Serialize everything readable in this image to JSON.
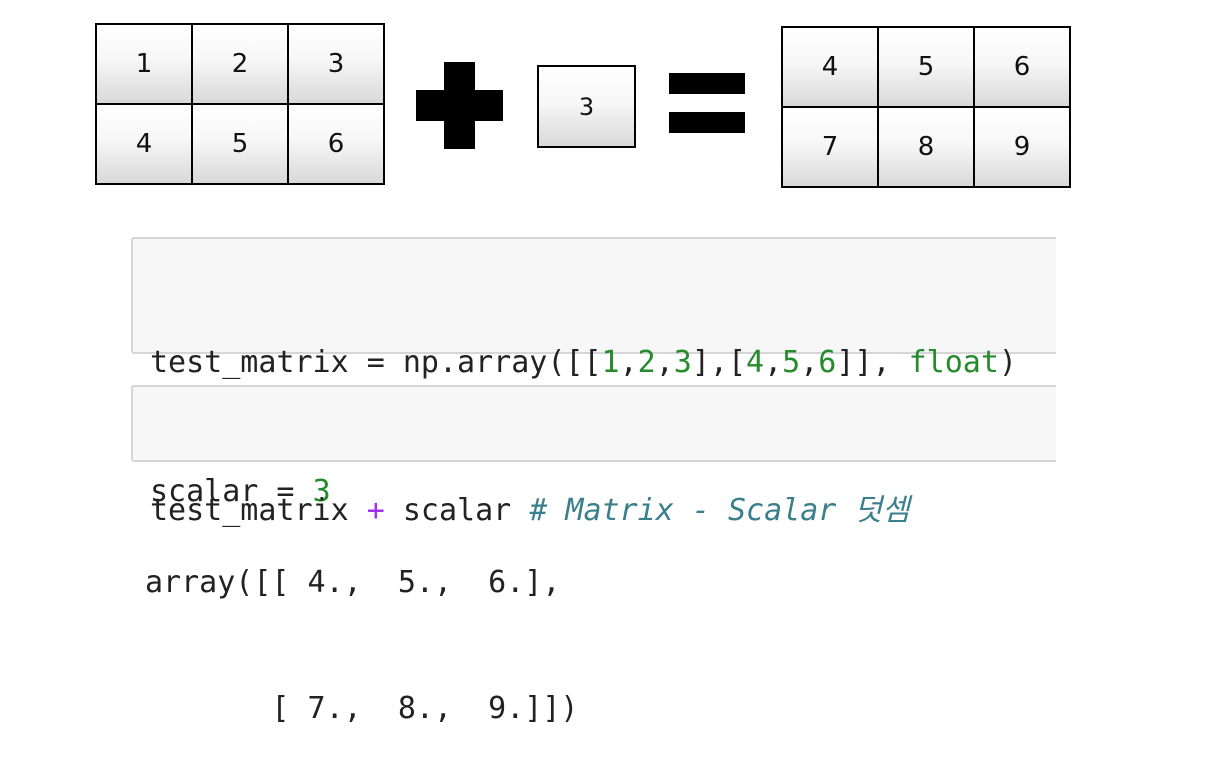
{
  "diagram": {
    "matrix_left": {
      "rows": [
        [
          "1",
          "2",
          "3"
        ],
        [
          "4",
          "5",
          "6"
        ]
      ]
    },
    "scalar": "3",
    "matrix_result": {
      "rows": [
        [
          "4",
          "5",
          "6"
        ],
        [
          "7",
          "8",
          "9"
        ]
      ]
    },
    "operator_plus_icon": "plus-icon",
    "operator_equals_icon": "equals-icon"
  },
  "code_cells": [
    {
      "lines": [
        [
          {
            "text": "test_matrix = np.array([[",
            "kind": "plain"
          },
          {
            "text": "1",
            "kind": "num"
          },
          {
            "text": ",",
            "kind": "plain"
          },
          {
            "text": "2",
            "kind": "num"
          },
          {
            "text": ",",
            "kind": "plain"
          },
          {
            "text": "3",
            "kind": "num"
          },
          {
            "text": "],[",
            "kind": "plain"
          },
          {
            "text": "4",
            "kind": "num"
          },
          {
            "text": ",",
            "kind": "plain"
          },
          {
            "text": "5",
            "kind": "num"
          },
          {
            "text": ",",
            "kind": "plain"
          },
          {
            "text": "6",
            "kind": "num"
          },
          {
            "text": "]], ",
            "kind": "plain"
          },
          {
            "text": "float",
            "kind": "builtin"
          },
          {
            "text": ")",
            "kind": "plain"
          }
        ],
        [
          {
            "text": "scalar = ",
            "kind": "plain"
          },
          {
            "text": "3",
            "kind": "num"
          }
        ]
      ]
    },
    {
      "lines": [
        [
          {
            "text": "test_matrix ",
            "kind": "plain"
          },
          {
            "text": "+",
            "kind": "op"
          },
          {
            "text": " scalar ",
            "kind": "plain"
          },
          {
            "text": "# Matrix - Scalar 덧셈",
            "kind": "comment"
          }
        ]
      ]
    }
  ],
  "output": {
    "lines": [
      "array([[ 4.,  5.,  6.],",
      "       [ 7.,  8.,  9.]])"
    ]
  },
  "colors": {
    "number": "#268b2d",
    "builtin": "#268b2d",
    "operator": "#a22ef0",
    "comment": "#3a7f8c",
    "cell_background": "#f7f7f7",
    "cell_border": "#d6d6d6"
  }
}
